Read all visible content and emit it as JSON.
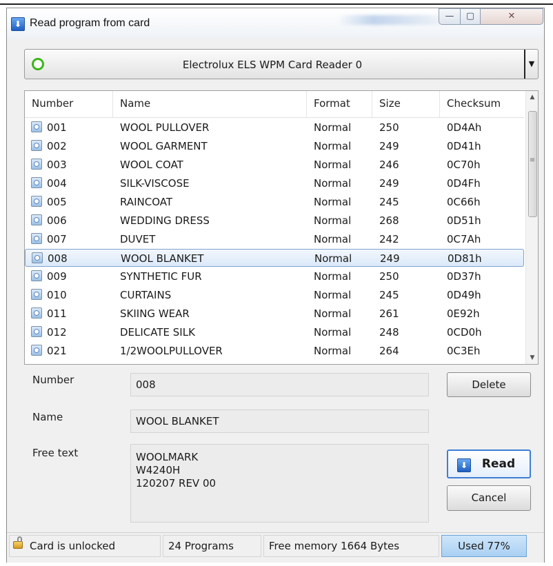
{
  "window": {
    "title": "Read program from card",
    "blurred_title_text": "",
    "buttons": {
      "minimize": "—",
      "maximize": "▢",
      "close": "✕"
    }
  },
  "reader": {
    "label": "Electrolux ELS WPM Card Reader 0"
  },
  "columns": [
    "Number",
    "Name",
    "Format",
    "Size",
    "Checksum"
  ],
  "programs": [
    {
      "number": "001",
      "name": "WOOL PULLOVER",
      "format": "Normal",
      "size": "250",
      "checksum": "0D4Ah"
    },
    {
      "number": "002",
      "name": "WOOL GARMENT",
      "format": "Normal",
      "size": "249",
      "checksum": "0D41h"
    },
    {
      "number": "003",
      "name": "WOOL COAT",
      "format": "Normal",
      "size": "246",
      "checksum": "0C70h"
    },
    {
      "number": "004",
      "name": "SILK-VISCOSE",
      "format": "Normal",
      "size": "249",
      "checksum": "0D4Fh"
    },
    {
      "number": "005",
      "name": "RAINCOAT",
      "format": "Normal",
      "size": "245",
      "checksum": "0C66h"
    },
    {
      "number": "006",
      "name": "WEDDING DRESS",
      "format": "Normal",
      "size": "268",
      "checksum": "0D51h"
    },
    {
      "number": "007",
      "name": "DUVET",
      "format": "Normal",
      "size": "242",
      "checksum": "0C7Ah"
    },
    {
      "number": "008",
      "name": "WOOL BLANKET",
      "format": "Normal",
      "size": "249",
      "checksum": "0D81h"
    },
    {
      "number": "009",
      "name": "SYNTHETIC FUR",
      "format": "Normal",
      "size": "250",
      "checksum": "0D37h"
    },
    {
      "number": "010",
      "name": "CURTAINS",
      "format": "Normal",
      "size": "245",
      "checksum": "0D49h"
    },
    {
      "number": "011",
      "name": "SKIING WEAR",
      "format": "Normal",
      "size": "261",
      "checksum": "0E92h"
    },
    {
      "number": "012",
      "name": "DELICATE SILK",
      "format": "Normal",
      "size": "248",
      "checksum": "0CD0h"
    },
    {
      "number": "021",
      "name": "1/2WOOLPULLOVER",
      "format": "Normal",
      "size": "264",
      "checksum": "0C3Eh"
    }
  ],
  "selected_number": "008",
  "details": {
    "number_label": "Number",
    "number_value": "008",
    "name_label": "Name",
    "name_value": "WOOL BLANKET",
    "free_text_label": "Free text",
    "free_text_value": "WOOLMARK\nW4240H\n120207 REV 00"
  },
  "actions": {
    "delete": "Delete",
    "read": "Read",
    "cancel": "Cancel"
  },
  "status": {
    "lock": "Card is unlocked",
    "programs": "24 Programs",
    "free_memory": "Free memory 1664 Bytes",
    "used": "Used 77%"
  },
  "colors": {
    "accent": "#3c7fd6",
    "reader_indicator": "#3bb519",
    "selection": "#dbe9f9",
    "used_fill": "#a9cff2"
  }
}
